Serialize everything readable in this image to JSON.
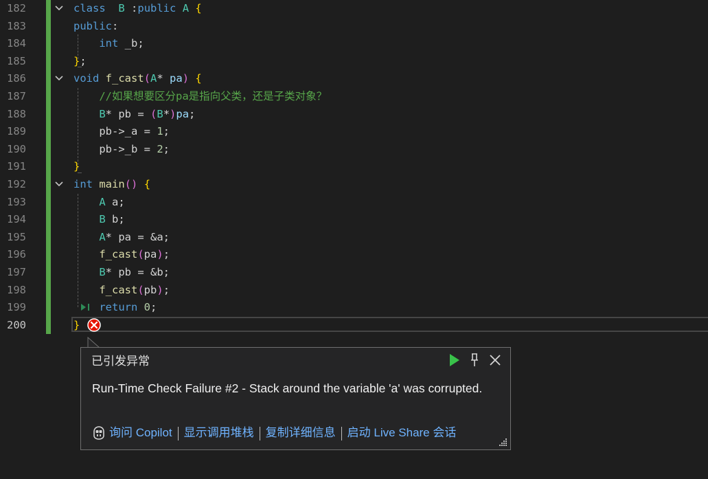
{
  "editor": {
    "lines": [
      {
        "n": "182",
        "tokens": [
          [
            "kw",
            "class"
          ],
          [
            "",
            "  "
          ],
          [
            "ty",
            "B"
          ],
          [
            "",
            " :"
          ],
          [
            "kw",
            "public"
          ],
          [
            "",
            " "
          ],
          [
            "ty",
            "A"
          ],
          [
            "",
            " "
          ],
          [
            "br",
            "{"
          ]
        ]
      },
      {
        "n": "183",
        "tokens": [
          [
            "kw",
            "public"
          ],
          [
            "",
            ":"
          ]
        ]
      },
      {
        "n": "184",
        "tokens": [
          [
            "",
            "    "
          ],
          [
            "kw",
            "int"
          ],
          [
            "",
            ""
          ],
          [
            "",
            " _b;"
          ]
        ]
      },
      {
        "n": "185",
        "tokens": [
          [
            "br",
            "}"
          ],
          [
            "",
            ";"
          ]
        ]
      },
      {
        "n": "186",
        "tokens": [
          [
            "kw",
            "void"
          ],
          [
            "",
            " "
          ],
          [
            "fn",
            "f_cast"
          ],
          [
            "br2",
            "("
          ],
          [
            "ty",
            "A"
          ],
          [
            "",
            "* "
          ],
          [
            "pm",
            "pa"
          ],
          [
            "br2",
            ")"
          ],
          [
            "",
            " "
          ],
          [
            "br",
            "{"
          ]
        ]
      },
      {
        "n": "187",
        "tokens": [
          [
            "",
            "    "
          ],
          [
            "cm",
            "//如果想要区分pa是指向父类，还是子类对象？"
          ]
        ]
      },
      {
        "n": "188",
        "tokens": [
          [
            "",
            "    "
          ],
          [
            "ty",
            "B"
          ],
          [
            "",
            "* pb = "
          ],
          [
            "br2",
            "("
          ],
          [
            "ty",
            "B"
          ],
          [
            "",
            "*"
          ],
          [
            "br2",
            ")"
          ],
          [
            "pm",
            "pa"
          ],
          [
            "",
            ";"
          ]
        ]
      },
      {
        "n": "189",
        "tokens": [
          [
            "",
            "    pb->_a = "
          ],
          [
            "nm",
            "1"
          ],
          [
            "",
            ";"
          ]
        ]
      },
      {
        "n": "190",
        "tokens": [
          [
            "",
            "    pb->_b = "
          ],
          [
            "nm",
            "2"
          ],
          [
            "",
            ";"
          ]
        ]
      },
      {
        "n": "191",
        "tokens": [
          [
            "br",
            "}"
          ]
        ]
      },
      {
        "n": "192",
        "tokens": [
          [
            "kw",
            "int"
          ],
          [
            "",
            " "
          ],
          [
            "fn",
            "main"
          ],
          [
            "br2",
            "()"
          ],
          [
            "",
            " "
          ],
          [
            "br",
            "{"
          ]
        ]
      },
      {
        "n": "193",
        "tokens": [
          [
            "",
            "    "
          ],
          [
            "ty",
            "A"
          ],
          [
            "",
            " a;"
          ]
        ]
      },
      {
        "n": "194",
        "tokens": [
          [
            "",
            "    "
          ],
          [
            "ty",
            "B"
          ],
          [
            "",
            " b;"
          ]
        ]
      },
      {
        "n": "195",
        "tokens": [
          [
            "",
            "    "
          ],
          [
            "ty",
            "A"
          ],
          [
            "",
            "* pa = &a;"
          ]
        ]
      },
      {
        "n": "196",
        "tokens": [
          [
            "",
            "    "
          ],
          [
            "fn",
            "f_cast"
          ],
          [
            "br2",
            "("
          ],
          [
            "",
            "pa"
          ],
          [
            "br2",
            ")"
          ],
          [
            "",
            ";"
          ]
        ]
      },
      {
        "n": "197",
        "tokens": [
          [
            "",
            "    "
          ],
          [
            "ty",
            "B"
          ],
          [
            "",
            "* pb = &b;"
          ]
        ]
      },
      {
        "n": "198",
        "tokens": [
          [
            "",
            "    "
          ],
          [
            "fn",
            "f_cast"
          ],
          [
            "br2",
            "("
          ],
          [
            "",
            "pb"
          ],
          [
            "br2",
            ")"
          ],
          [
            "",
            ";"
          ]
        ]
      },
      {
        "n": "199",
        "tokens": [
          [
            "",
            "    "
          ],
          [
            "kw",
            "return"
          ],
          [
            "",
            " "
          ],
          [
            "nm",
            "0"
          ],
          [
            "",
            ";"
          ]
        ]
      },
      {
        "n": "200",
        "tokens": [
          [
            "br",
            "}"
          ]
        ]
      }
    ]
  },
  "exception_popup": {
    "title": "已引发异常",
    "message": "Run-Time Check Failure #2 - Stack around the variable 'a' was corrupted.",
    "links": {
      "ask_copilot": "询问 Copilot",
      "show_call_stack": "显示调用堆栈",
      "copy_details": "复制详细信息",
      "start_live_share": "启动 Live Share 会话"
    },
    "icons": {
      "continue": "play-icon",
      "pin": "pin-icon",
      "close": "close-icon",
      "copilot": "copilot-icon"
    }
  },
  "colors": {
    "background": "#1e1e1e",
    "keyword": "#569cd6",
    "type": "#4ec9b0",
    "function": "#dcdcaa",
    "comment": "#57a64a",
    "number": "#b5cea8",
    "change_bar": "#57a64a",
    "error": "#e51400",
    "link": "#6fb3ff"
  }
}
